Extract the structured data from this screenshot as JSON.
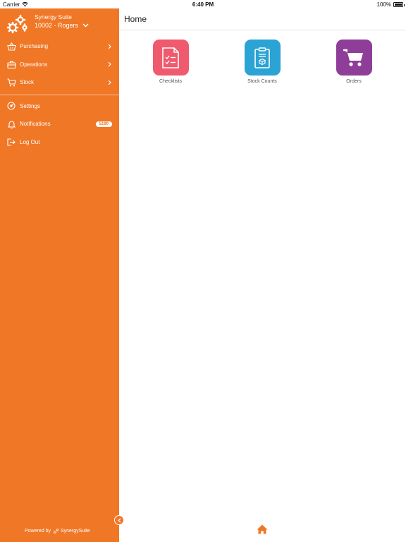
{
  "status_bar": {
    "carrier": "Carrier",
    "time": "6:40 PM",
    "battery": "100%"
  },
  "sidebar": {
    "brand_name": "Synergy Suite",
    "store": "10002 - Rogers",
    "menu": [
      {
        "label": "Purchasing",
        "icon": "basket-icon"
      },
      {
        "label": "Operations",
        "icon": "briefcase-icon"
      },
      {
        "label": "Stock",
        "icon": "cart-icon"
      }
    ],
    "settings_label": "Settings",
    "notifications_label": "Notifications",
    "notifications_count": "5190",
    "logout_label": "Log Out",
    "powered_by": "Powered by",
    "powered_brand": "SynergySuite"
  },
  "main": {
    "title": "Home",
    "tiles": [
      {
        "label": "Checklists",
        "color": "#F05A6E",
        "icon": "checklist-icon"
      },
      {
        "label": "Stock Counts",
        "color": "#2BA3D4",
        "icon": "clipboard-box-icon"
      },
      {
        "label": "Orders",
        "color": "#8E3D98",
        "icon": "cart-icon"
      }
    ]
  },
  "colors": {
    "sidebar": "#F07726",
    "home_icon": "#F07726"
  }
}
